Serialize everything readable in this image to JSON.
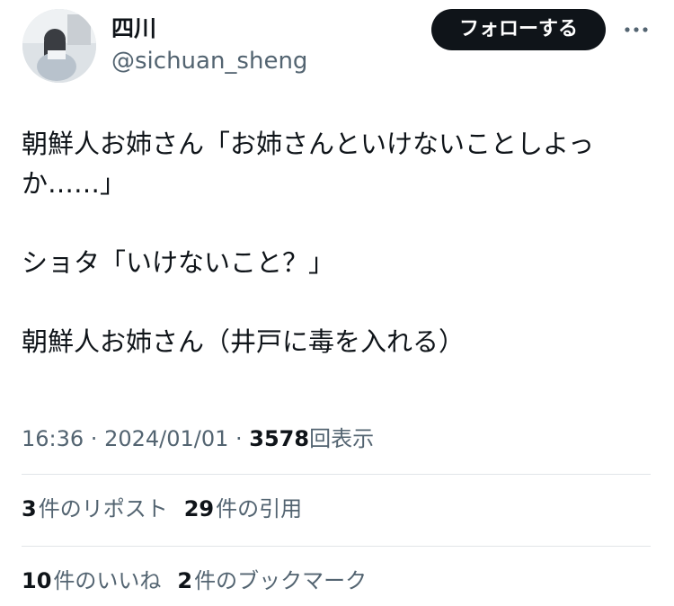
{
  "author": {
    "display_name": "四川",
    "handle": "@sichuan_sheng",
    "avatar_icon": "profile-photo"
  },
  "follow_button_label": "フォローする",
  "more_icon": "more-horizontal-icon",
  "tweet": {
    "lines": [
      "朝鮮人お姉さん「お姉さんといけないことしよっ",
      "か……」",
      "ショタ「いけないこと？」",
      "朝鮮人お姉さん（井戸に毒を入れる）"
    ]
  },
  "meta": {
    "time": "16:36",
    "date": "2024/01/01",
    "separator": " · ",
    "views_count": "3578",
    "views_label": "回表示"
  },
  "stats": {
    "reposts_count": "3",
    "reposts_label": "件のリポスト",
    "quotes_count": "29",
    "quotes_label": "件の引用",
    "likes_count": "10",
    "likes_label": "件のいいね",
    "bookmarks_count": "2",
    "bookmarks_label": "件のブックマーク"
  },
  "colors": {
    "text_primary": "#0f1419",
    "text_secondary": "#536471",
    "divider": "#e1e5e8",
    "button_bg": "#0f1419",
    "button_text": "#ffffff"
  }
}
